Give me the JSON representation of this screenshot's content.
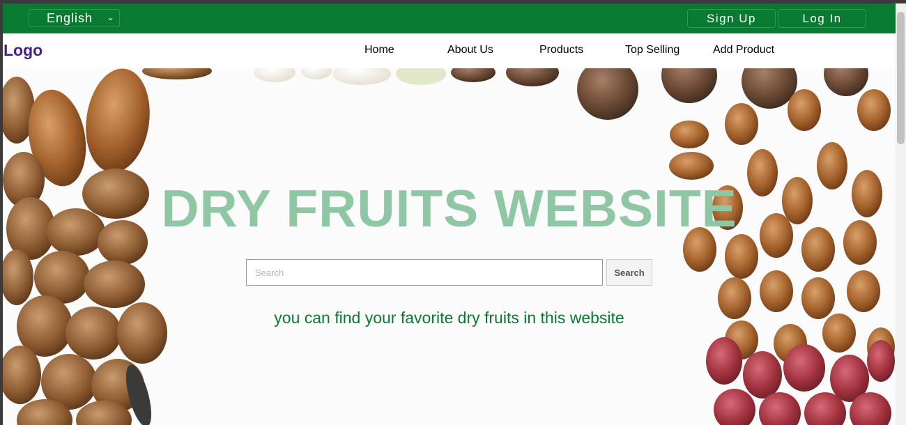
{
  "topbar": {
    "language": "English",
    "signup_label": "Sign Up",
    "login_label": "Log In"
  },
  "navbar": {
    "logo": "Logo",
    "items": [
      "Home",
      "About Us",
      "Products",
      "Top Selling",
      "Add Product"
    ]
  },
  "hero": {
    "title": "DRY FRUITS WEBSITE",
    "search_placeholder": "Search",
    "search_button": "Search",
    "tagline": "you can find your favorite dry fruits in this website"
  },
  "colors": {
    "topbar": "#0a7a32",
    "logo": "#4b1f8a",
    "title": "#8fc7a4",
    "tagline": "#0a7a32"
  },
  "icons": {
    "language_dropdown": "chevron-down-icon"
  }
}
